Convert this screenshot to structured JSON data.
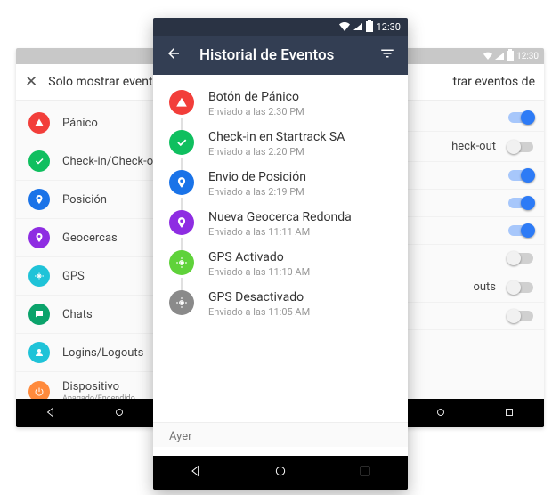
{
  "status": {
    "time": "12:30"
  },
  "back_left": {
    "header": "Solo mostrar event",
    "items": [
      {
        "label": "Pánico",
        "color": "c-red",
        "icon": "warning"
      },
      {
        "label": "Check-in/Check-out",
        "color": "c-green",
        "icon": "check"
      },
      {
        "label": "Posición",
        "color": "c-blue",
        "icon": "pin"
      },
      {
        "label": "Geocercas",
        "color": "c-purple",
        "icon": "pin"
      },
      {
        "label": "GPS",
        "color": "c-cyan",
        "icon": "gps"
      },
      {
        "label": "Chats",
        "color": "c-teal",
        "icon": "chat"
      },
      {
        "label": "Logins/Logouts",
        "color": "c-cyan",
        "icon": "login"
      },
      {
        "label": "Dispositivo",
        "sub": "Apagado/Encendido",
        "color": "c-orange",
        "icon": "power"
      }
    ]
  },
  "back_right": {
    "header": "trar eventos de",
    "items": [
      {
        "label": "",
        "on": true
      },
      {
        "label": "heck-out",
        "on": false
      },
      {
        "label": "",
        "on": true
      },
      {
        "label": "",
        "on": true
      },
      {
        "label": "",
        "on": true
      },
      {
        "label": "",
        "on": false
      },
      {
        "label": "outs",
        "on": false
      },
      {
        "label": "",
        "on": false
      }
    ]
  },
  "front": {
    "title": "Historial de Eventos",
    "events": [
      {
        "title": "Botón de Pánico",
        "sub": "Enviado a las 2:30 PM",
        "color": "c-red",
        "icon": "warning"
      },
      {
        "title": "Check-in en Startrack SA",
        "sub": "Enviado a las 2:20 PM",
        "color": "c-green",
        "icon": "check"
      },
      {
        "title": "Envio de Posición",
        "sub": "Enviado a las 2:19 PM",
        "color": "c-blue",
        "icon": "pin"
      },
      {
        "title": "Nueva Geocerca Redonda",
        "sub": "Enviado a las 11:11 AM",
        "color": "c-purple",
        "icon": "pin"
      },
      {
        "title": "GPS Activado",
        "sub": "Enviado a las 11:10 AM",
        "color": "c-lime",
        "icon": "gps"
      },
      {
        "title": "GPS Desactivado",
        "sub": "Enviado a las 11:05 AM",
        "color": "c-grey",
        "icon": "gps"
      }
    ],
    "section": "Ayer"
  }
}
